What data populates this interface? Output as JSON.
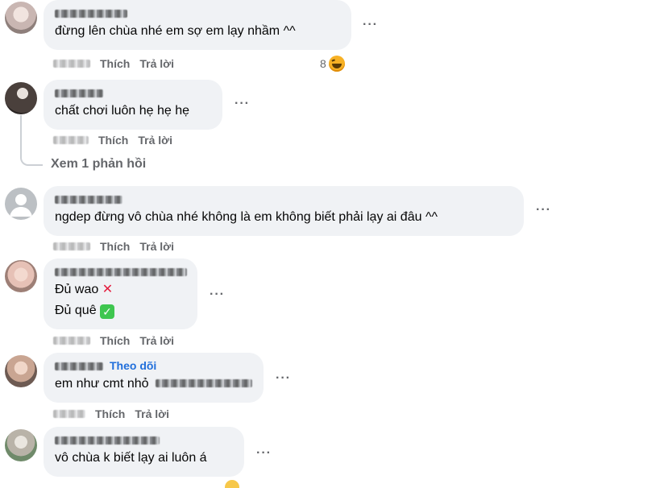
{
  "actions": {
    "like_label": "Thích",
    "reply_label": "Trả lời",
    "more": "···"
  },
  "comments": [
    {
      "text": "đừng lên chùa nhé em sợ em lạy nhầm ^^",
      "reaction_count": "8"
    },
    {
      "text": "chất chơi luôn hẹ hẹ hẹ",
      "view_replies": "Xem 1 phản hồi"
    },
    {
      "text": "ngdep đừng vô chùa nhé không là em không biết phải lạy ai đâu ^^"
    },
    {
      "line1": "Đủ wao",
      "line1_emoji": "✕",
      "line2": "Đủ quê",
      "line2_emoji": "✓"
    },
    {
      "follow_label": "Theo dõi",
      "text": "em như cmt nhỏ"
    },
    {
      "text": "vô chùa k biết lạy ai luôn á"
    }
  ],
  "colors": {
    "bubble": "#f0f2f5",
    "secondary_text": "#65676b",
    "link": "#216fdb"
  }
}
